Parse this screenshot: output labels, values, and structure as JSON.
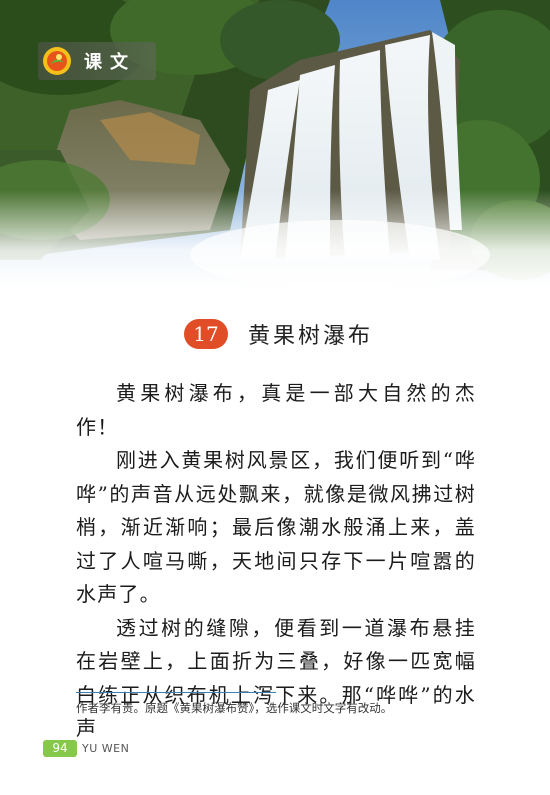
{
  "header": {
    "section_label": "课文"
  },
  "lesson": {
    "number": "17",
    "title": "黄果树瀑布"
  },
  "body": {
    "paragraphs": [
      "黄果树瀑布，真是一部大自然的杰作！",
      "刚进入黄果树风景区，我们便听到“哗哗”的声音从远处飘来，就像是微风拂过树梢，渐近渐响；最后像潮水般涌上来，盖过了人喧马嘶，天地间只存下一片喧嚣的水声了。",
      "透过树的缝隙，便看到一道瀑布悬挂在岩壁上，上面折为三叠，好像一匹宽幅白练正从织布机上泻下来。那“哗哗”的水声"
    ]
  },
  "footnote": {
    "text": "作者李有贵。原题《黄果树瀑布赞》，选作课文时文字有改动。"
  },
  "page": {
    "number": "94",
    "subject": "YU WEN"
  },
  "colors": {
    "lesson_badge": "#e14d26",
    "page_badge": "#86c84a",
    "footnote_rule": "#3a7fb5"
  }
}
